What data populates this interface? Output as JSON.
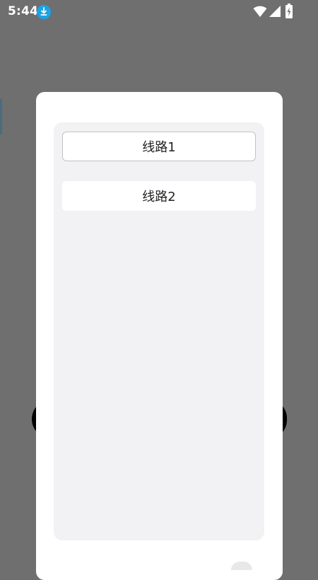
{
  "status_bar": {
    "time": "5:44",
    "icons": [
      "download-icon",
      "wifi-icon",
      "signal-icon",
      "battery-charging-icon"
    ]
  },
  "dialog": {
    "routes": [
      {
        "label": "线路1",
        "selected": true
      },
      {
        "label": "线路2",
        "selected": false
      }
    ]
  },
  "colors": {
    "overlay": "#6f6f6f",
    "dialog_bg": "#ffffff",
    "panel_bg": "#f2f2f4",
    "download_badge": "#1aa3e8"
  }
}
